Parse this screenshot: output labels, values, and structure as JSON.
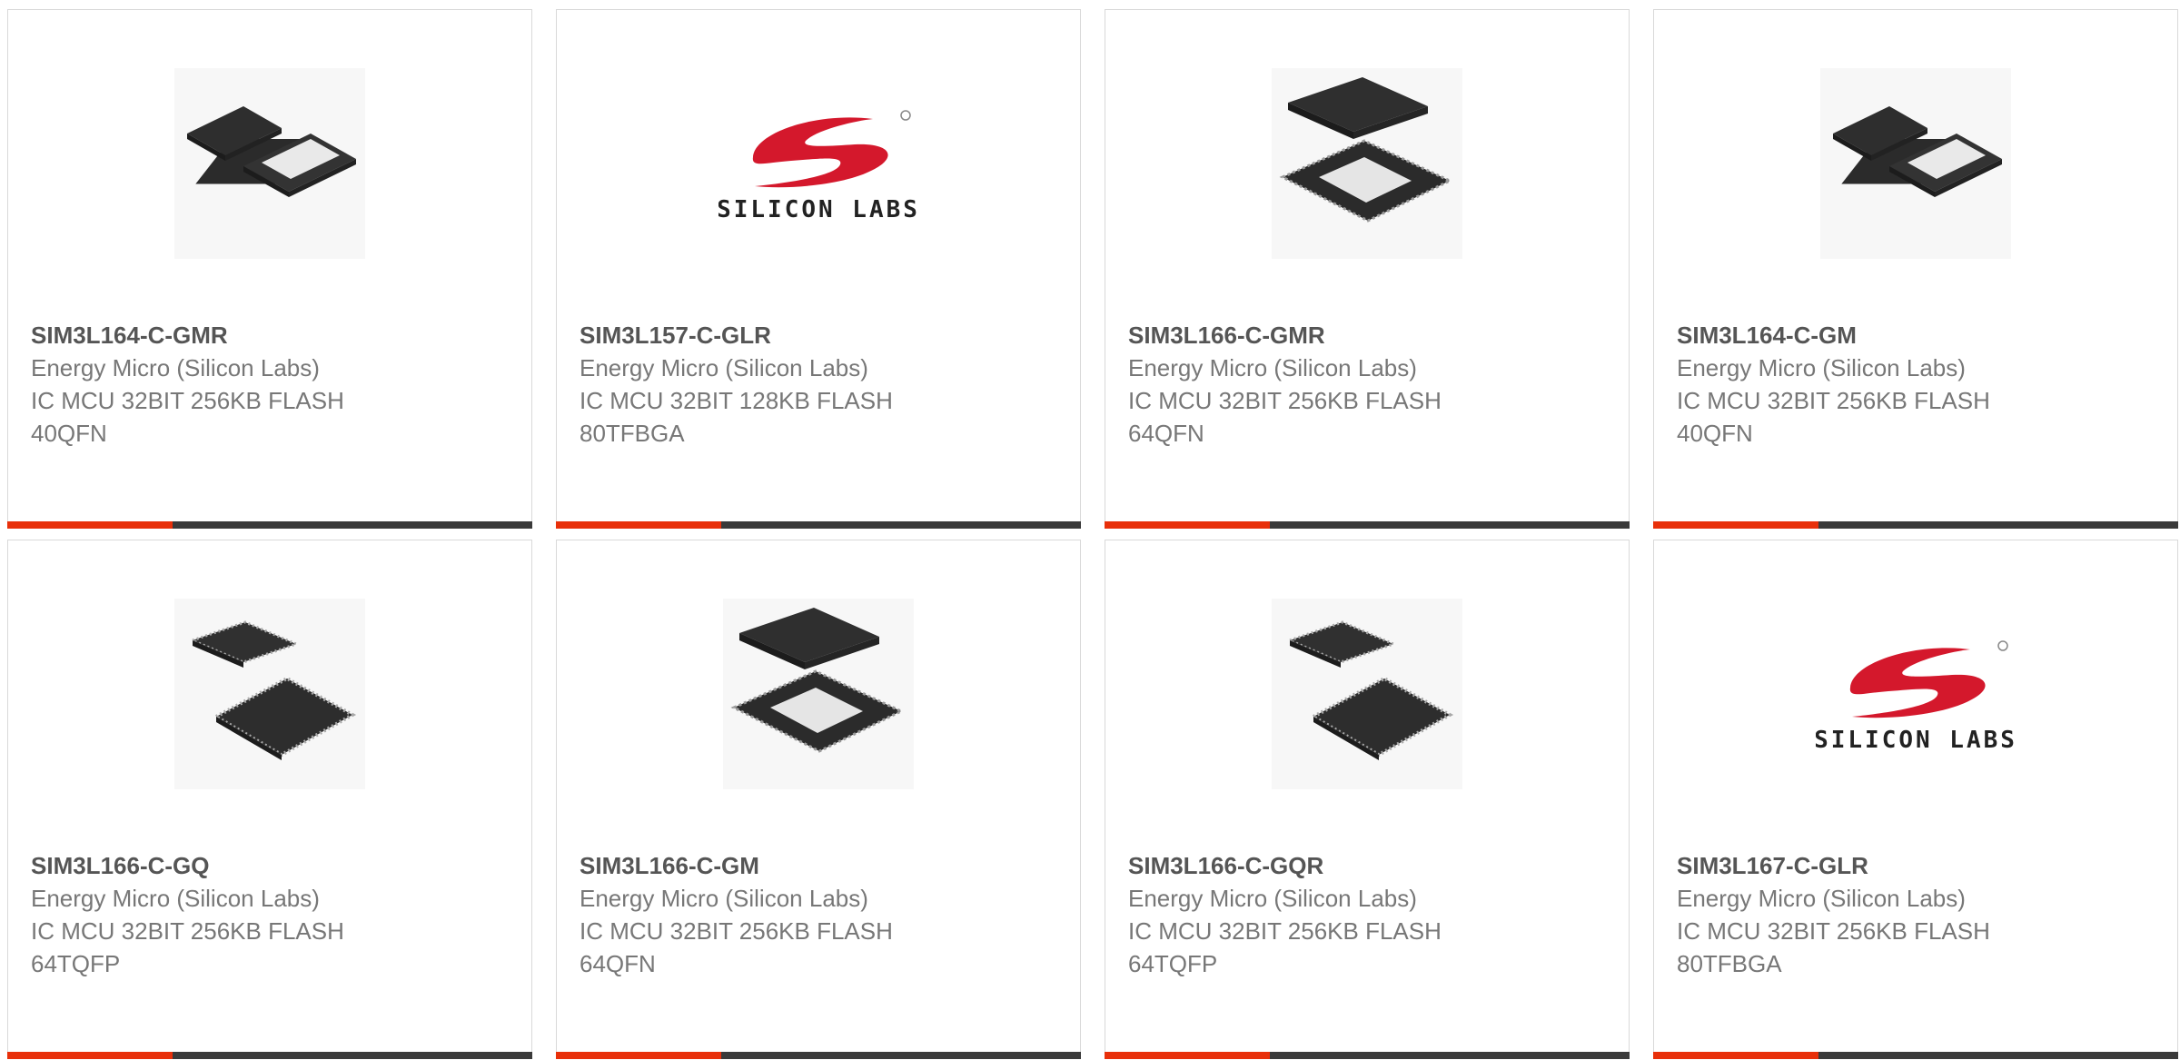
{
  "colors": {
    "accent": "#e8300a",
    "bar_dark": "#3a3a3a",
    "logo_red": "#d4182c"
  },
  "products": [
    {
      "part": "SIM3L164-C-GMR",
      "manufacturer": "Energy Micro (Silicon Labs)",
      "description": "IC MCU 32BIT 256KB FLASH",
      "package": "40QFN",
      "image": "qfn-chip-pair-icon"
    },
    {
      "part": "SIM3L157-C-GLR",
      "manufacturer": "Energy Micro (Silicon Labs)",
      "description": "IC MCU 32BIT 128KB FLASH",
      "package": "80TFBGA",
      "image": "silicon-labs-logo",
      "logo_text": "SILICON LABS"
    },
    {
      "part": "SIM3L166-C-GMR",
      "manufacturer": "Energy Micro (Silicon Labs)",
      "description": "IC MCU 32BIT 256KB FLASH",
      "package": "64QFN",
      "image": "qfn64-chip-stack-icon"
    },
    {
      "part": "SIM3L164-C-GM",
      "manufacturer": "Energy Micro (Silicon Labs)",
      "description": "IC MCU 32BIT 256KB FLASH",
      "package": "40QFN",
      "image": "qfn-chip-pair-icon"
    },
    {
      "part": "SIM3L166-C-GQ",
      "manufacturer": "Energy Micro (Silicon Labs)",
      "description": "IC MCU 32BIT 256KB FLASH",
      "package": "64TQFP",
      "image": "tqfp-chip-pair-icon"
    },
    {
      "part": "SIM3L166-C-GM",
      "manufacturer": "Energy Micro (Silicon Labs)",
      "description": "IC MCU 32BIT 256KB FLASH",
      "package": "64QFN",
      "image": "qfn64-chip-stack-icon"
    },
    {
      "part": "SIM3L166-C-GQR",
      "manufacturer": "Energy Micro (Silicon Labs)",
      "description": "IC MCU 32BIT 256KB FLASH",
      "package": "64TQFP",
      "image": "tqfp-chip-pair-icon"
    },
    {
      "part": "SIM3L167-C-GLR",
      "manufacturer": "Energy Micro (Silicon Labs)",
      "description": "IC MCU 32BIT 256KB FLASH",
      "package": "80TFBGA",
      "image": "silicon-labs-logo",
      "logo_text": "SILICON LABS"
    }
  ]
}
